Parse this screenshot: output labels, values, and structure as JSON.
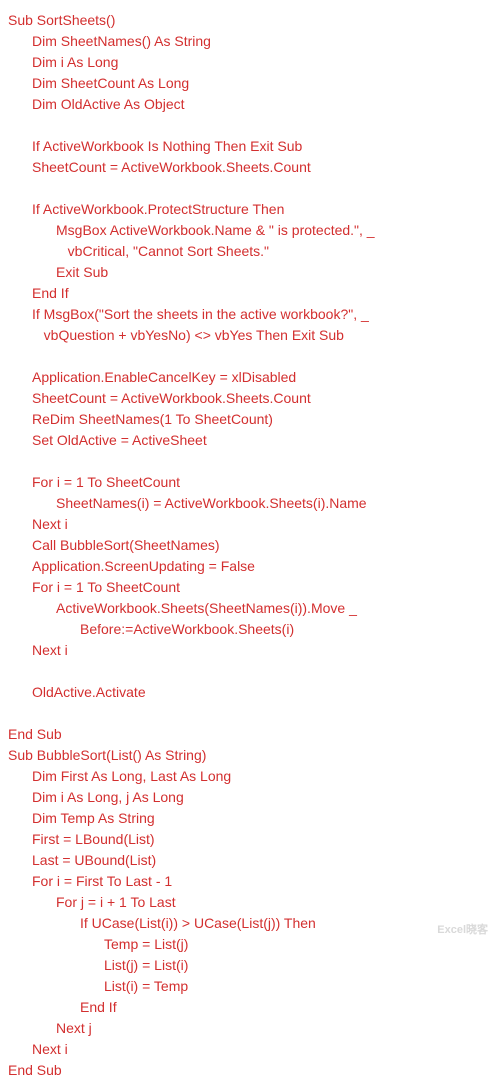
{
  "code": {
    "lines": [
      {
        "indent": 0,
        "text": "Sub SortSheets()"
      },
      {
        "indent": 1,
        "text": "Dim SheetNames() As String"
      },
      {
        "indent": 1,
        "text": "Dim i As Long"
      },
      {
        "indent": 1,
        "text": "Dim SheetCount As Long"
      },
      {
        "indent": 1,
        "text": "Dim OldActive As Object"
      },
      {
        "indent": 0,
        "text": ""
      },
      {
        "indent": 1,
        "text": "If ActiveWorkbook Is Nothing Then Exit Sub"
      },
      {
        "indent": 1,
        "text": "SheetCount = ActiveWorkbook.Sheets.Count"
      },
      {
        "indent": 0,
        "text": ""
      },
      {
        "indent": 1,
        "text": "If ActiveWorkbook.ProtectStructure Then"
      },
      {
        "indent": 2,
        "text": "MsgBox ActiveWorkbook.Name & \" is protected.\", _"
      },
      {
        "indent": 2,
        "text": "   vbCritical, \"Cannot Sort Sheets.\""
      },
      {
        "indent": 2,
        "text": "Exit Sub"
      },
      {
        "indent": 1,
        "text": "End If"
      },
      {
        "indent": 1,
        "text": "If MsgBox(\"Sort the sheets in the active workbook?\", _"
      },
      {
        "indent": 1,
        "text": "   vbQuestion + vbYesNo) <> vbYes Then Exit Sub"
      },
      {
        "indent": 0,
        "text": ""
      },
      {
        "indent": 1,
        "text": "Application.EnableCancelKey = xlDisabled"
      },
      {
        "indent": 1,
        "text": "SheetCount = ActiveWorkbook.Sheets.Count"
      },
      {
        "indent": 1,
        "text": "ReDim SheetNames(1 To SheetCount)"
      },
      {
        "indent": 1,
        "text": "Set OldActive = ActiveSheet"
      },
      {
        "indent": 0,
        "text": ""
      },
      {
        "indent": 1,
        "text": "For i = 1 To SheetCount"
      },
      {
        "indent": 2,
        "text": "SheetNames(i) = ActiveWorkbook.Sheets(i).Name"
      },
      {
        "indent": 1,
        "text": "Next i"
      },
      {
        "indent": 1,
        "text": "Call BubbleSort(SheetNames)"
      },
      {
        "indent": 1,
        "text": "Application.ScreenUpdating = False"
      },
      {
        "indent": 1,
        "text": "For i = 1 To SheetCount"
      },
      {
        "indent": 2,
        "text": "ActiveWorkbook.Sheets(SheetNames(i)).Move _"
      },
      {
        "indent": 3,
        "text": "Before:=ActiveWorkbook.Sheets(i)"
      },
      {
        "indent": 1,
        "text": "Next i"
      },
      {
        "indent": 0,
        "text": ""
      },
      {
        "indent": 1,
        "text": "OldActive.Activate"
      },
      {
        "indent": 0,
        "text": ""
      },
      {
        "indent": 0,
        "text": "End Sub"
      },
      {
        "indent": 0,
        "text": "Sub BubbleSort(List() As String)"
      },
      {
        "indent": 1,
        "text": "Dim First As Long, Last As Long"
      },
      {
        "indent": 1,
        "text": "Dim i As Long, j As Long"
      },
      {
        "indent": 1,
        "text": "Dim Temp As String"
      },
      {
        "indent": 1,
        "text": "First = LBound(List)"
      },
      {
        "indent": 1,
        "text": "Last = UBound(List)"
      },
      {
        "indent": 1,
        "text": "For i = First To Last - 1"
      },
      {
        "indent": 2,
        "text": "For j = i + 1 To Last"
      },
      {
        "indent": 3,
        "text": "If UCase(List(i)) > UCase(List(j)) Then"
      },
      {
        "indent": 4,
        "text": "Temp = List(j)"
      },
      {
        "indent": 4,
        "text": "List(j) = List(i)"
      },
      {
        "indent": 4,
        "text": "List(i) = Temp"
      },
      {
        "indent": 3,
        "text": "End If"
      },
      {
        "indent": 2,
        "text": "Next j"
      },
      {
        "indent": 1,
        "text": "Next i"
      },
      {
        "indent": 0,
        "text": "End Sub"
      }
    ]
  },
  "watermark": "Excel晓客"
}
